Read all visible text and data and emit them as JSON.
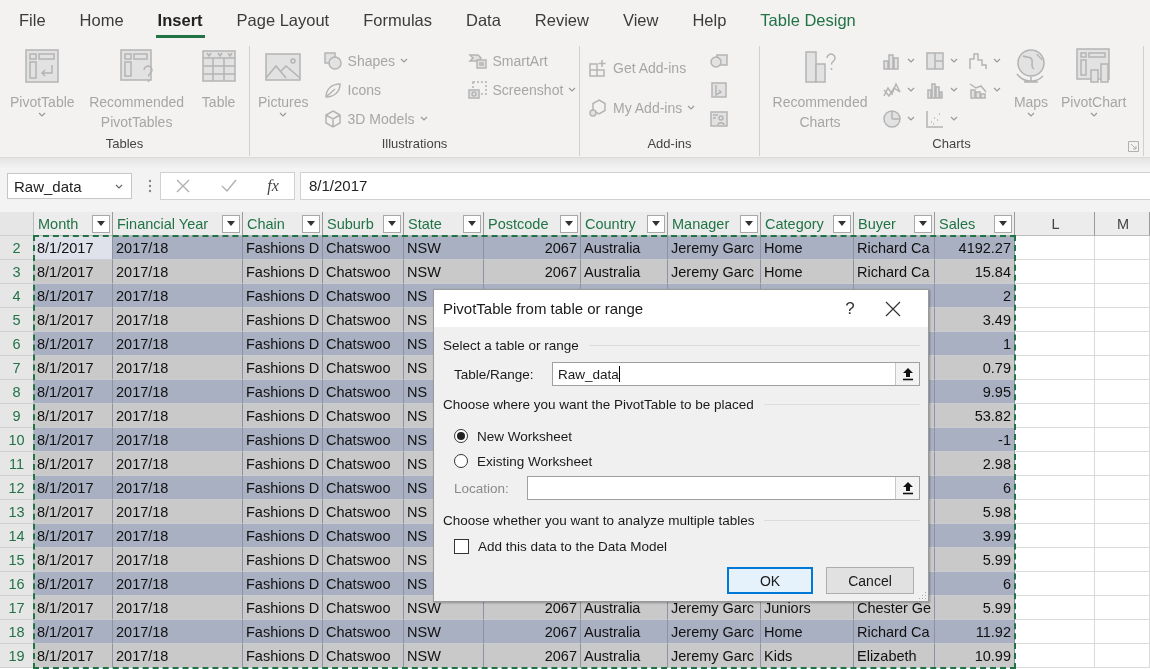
{
  "ribbon_tabs": [
    {
      "label": "File",
      "selected": false,
      "kind": "standard"
    },
    {
      "label": "Home",
      "selected": false,
      "kind": "standard"
    },
    {
      "label": "Insert",
      "selected": true,
      "kind": "standard"
    },
    {
      "label": "Page Layout",
      "selected": false,
      "kind": "standard"
    },
    {
      "label": "Formulas",
      "selected": false,
      "kind": "standard"
    },
    {
      "label": "Data",
      "selected": false,
      "kind": "standard"
    },
    {
      "label": "Review",
      "selected": false,
      "kind": "standard"
    },
    {
      "label": "View",
      "selected": false,
      "kind": "standard"
    },
    {
      "label": "Help",
      "selected": false,
      "kind": "standard"
    },
    {
      "label": "Table Design",
      "selected": false,
      "kind": "contextual"
    }
  ],
  "ribbon": {
    "disabled": true,
    "groups": [
      {
        "label": "Tables",
        "launcher": false,
        "items": [
          {
            "kind": "large",
            "label": "PivotTable",
            "dropdown": true
          },
          {
            "kind": "large",
            "label": "Recommended PivotTables",
            "dropdown": false
          },
          {
            "kind": "large",
            "label": "Table",
            "dropdown": false
          }
        ]
      },
      {
        "label": "Illustrations",
        "launcher": false,
        "items": [
          {
            "kind": "large",
            "label": "Pictures",
            "dropdown": true
          },
          {
            "kind": "stack",
            "buttons": [
              {
                "kind": "small",
                "label": "Shapes",
                "dropdown": true
              },
              {
                "kind": "small",
                "label": "Icons",
                "dropdown": false
              },
              {
                "kind": "small",
                "label": "3D Models",
                "dropdown": true
              }
            ]
          },
          {
            "kind": "stack",
            "buttons": [
              {
                "kind": "small",
                "label": "SmartArt",
                "dropdown": false
              },
              {
                "kind": "small",
                "label": "Screenshot",
                "dropdown": true
              }
            ]
          }
        ]
      },
      {
        "label": "Add-ins",
        "launcher": false,
        "items": [
          {
            "kind": "stack",
            "buttons": [
              {
                "kind": "small",
                "label": "Get Add-ins",
                "dropdown": false
              },
              {
                "kind": "small",
                "label": "My Add-ins",
                "dropdown": true
              }
            ]
          },
          {
            "kind": "stack",
            "buttons": [
              {
                "kind": "icon",
                "dropdown": false
              },
              {
                "kind": "icon",
                "dropdown": false
              },
              {
                "kind": "icon",
                "dropdown": false
              }
            ]
          }
        ]
      },
      {
        "label": "Charts",
        "launcher": true,
        "items": [
          {
            "kind": "large",
            "label": "Recommended Charts",
            "dropdown": false
          },
          {
            "kind": "stack",
            "buttons": [
              {
                "kind": "icon",
                "dropdown": true
              },
              {
                "kind": "icon",
                "dropdown": true
              },
              {
                "kind": "icon",
                "dropdown": true
              }
            ]
          },
          {
            "kind": "stack",
            "buttons": [
              {
                "kind": "icon",
                "dropdown": true
              },
              {
                "kind": "icon",
                "dropdown": true
              },
              {
                "kind": "icon",
                "dropdown": true
              }
            ]
          },
          {
            "kind": "stack",
            "buttons": [
              {
                "kind": "icon",
                "dropdown": true
              },
              {
                "kind": "icon",
                "dropdown": true
              }
            ]
          },
          {
            "kind": "large",
            "label": "Maps",
            "dropdown": true
          },
          {
            "kind": "large",
            "label": "PivotChart",
            "dropdown": true
          }
        ]
      }
    ]
  },
  "formula_bar": {
    "name_box": "Raw_data",
    "function_label": "fx",
    "formula": "8/1/2017"
  },
  "sheet": {
    "marquee": true,
    "columns": [
      {
        "label": "Month",
        "kind": "text"
      },
      {
        "label": "Financial Year",
        "kind": "text"
      },
      {
        "label": "Chain",
        "kind": "text"
      },
      {
        "label": "Suburb",
        "kind": "text"
      },
      {
        "label": "State",
        "kind": "text"
      },
      {
        "label": "Postcode",
        "kind": "number"
      },
      {
        "label": "Country",
        "kind": "text"
      },
      {
        "label": "Manager",
        "kind": "text"
      },
      {
        "label": "Category",
        "kind": "text"
      },
      {
        "label": "Buyer",
        "kind": "text"
      },
      {
        "label": "Sales",
        "kind": "number"
      },
      {
        "label": "L",
        "kind": "letter"
      },
      {
        "label": "M",
        "kind": "letter"
      }
    ],
    "rows": [
      {
        "number": "2",
        "active": true,
        "cells": [
          "8/1/2017",
          "2017/18",
          "Fashions D",
          "Chatswoo",
          "NSW",
          "2067",
          "Australia",
          "Jeremy Garc",
          "Home",
          "Richard Ca",
          "4192.27"
        ]
      },
      {
        "number": "3",
        "active": false,
        "cells": [
          "8/1/2017",
          "2017/18",
          "Fashions D",
          "Chatswoo",
          "NSW",
          "2067",
          "Australia",
          "Jeremy Garc",
          "Home",
          "Richard Ca",
          "15.84"
        ]
      },
      {
        "number": "4",
        "active": false,
        "cells": [
          "8/1/2017",
          "2017/18",
          "Fashions D",
          "Chatswoo",
          "NS"
        ],
        "end_cells": [
          "2"
        ]
      },
      {
        "number": "5",
        "active": false,
        "cells": [
          "8/1/2017",
          "2017/18",
          "Fashions D",
          "Chatswoo",
          "NS"
        ],
        "end_cells": [
          "3.49"
        ]
      },
      {
        "number": "6",
        "active": false,
        "cells": [
          "8/1/2017",
          "2017/18",
          "Fashions D",
          "Chatswoo",
          "NS"
        ],
        "end_cells": [
          "1"
        ]
      },
      {
        "number": "7",
        "active": false,
        "cells": [
          "8/1/2017",
          "2017/18",
          "Fashions D",
          "Chatswoo",
          "NS"
        ],
        "end_cells": [
          "0.79"
        ]
      },
      {
        "number": "8",
        "active": false,
        "cells": [
          "8/1/2017",
          "2017/18",
          "Fashions D",
          "Chatswoo",
          "NS"
        ],
        "end_cells": [
          "9.95"
        ]
      },
      {
        "number": "9",
        "active": false,
        "cells": [
          "8/1/2017",
          "2017/18",
          "Fashions D",
          "Chatswoo",
          "NS"
        ],
        "end_cells": [
          "53.82"
        ]
      },
      {
        "number": "10",
        "active": false,
        "cells": [
          "8/1/2017",
          "2017/18",
          "Fashions D",
          "Chatswoo",
          "NS"
        ],
        "end_cells": [
          "-1"
        ]
      },
      {
        "number": "11",
        "active": false,
        "cells": [
          "8/1/2017",
          "2017/18",
          "Fashions D",
          "Chatswoo",
          "NS"
        ],
        "end_cells": [
          "2.98"
        ]
      },
      {
        "number": "12",
        "active": false,
        "cells": [
          "8/1/2017",
          "2017/18",
          "Fashions D",
          "Chatswoo",
          "NS"
        ],
        "end_cells": [
          "6"
        ]
      },
      {
        "number": "13",
        "active": false,
        "cells": [
          "8/1/2017",
          "2017/18",
          "Fashions D",
          "Chatswoo",
          "NS"
        ],
        "end_cells": [
          "5.98"
        ]
      },
      {
        "number": "14",
        "active": false,
        "cells": [
          "8/1/2017",
          "2017/18",
          "Fashions D",
          "Chatswoo",
          "NS"
        ],
        "end_cells": [
          "3.99"
        ]
      },
      {
        "number": "15",
        "active": false,
        "cells": [
          "8/1/2017",
          "2017/18",
          "Fashions D",
          "Chatswoo",
          "NS"
        ],
        "end_cells": [
          "5.99"
        ]
      },
      {
        "number": "16",
        "active": false,
        "cells": [
          "8/1/2017",
          "2017/18",
          "Fashions D",
          "Chatswoo",
          "NS"
        ],
        "end_cells": [
          "6"
        ]
      },
      {
        "number": "17",
        "active": false,
        "cells": [
          "8/1/2017",
          "2017/18",
          "Fashions D",
          "Chatswoo",
          "NSW",
          "2067",
          "Australia",
          "Jeremy Garc",
          "Juniors",
          "Chester Ge",
          "5.99"
        ]
      },
      {
        "number": "18",
        "active": false,
        "cells": [
          "8/1/2017",
          "2017/18",
          "Fashions D",
          "Chatswoo",
          "NSW",
          "2067",
          "Australia",
          "Jeremy Garc",
          "Home",
          "Richard Ca",
          "11.92"
        ]
      },
      {
        "number": "19",
        "active": false,
        "cells": [
          "8/1/2017",
          "2017/18",
          "Fashions D",
          "Chatswoo",
          "NSW",
          "2067",
          "Australia",
          "Jeremy Garc",
          "Kids",
          "Elizabeth",
          "10.99"
        ]
      }
    ]
  },
  "dialog": {
    "title": "PivotTable from table or range",
    "help_label": "?",
    "source": {
      "heading": "Select a table or range",
      "label": "Table/Range:",
      "value": "Raw_data",
      "focused": true
    },
    "placement": {
      "heading": "Choose where you want the PivotTable to be placed",
      "options": [
        {
          "label": "New Worksheet",
          "selected": true
        },
        {
          "label": "Existing Worksheet",
          "selected": false
        }
      ],
      "location": {
        "label": "Location:",
        "disabled": true
      }
    },
    "analysis": {
      "heading": "Choose whether you want to analyze multiple tables",
      "checkbox": {
        "label": "Add this data to the Data Model",
        "checked": false
      }
    },
    "buttons": [
      {
        "label": "OK",
        "default": true
      },
      {
        "label": "Cancel",
        "default": false
      }
    ]
  }
}
